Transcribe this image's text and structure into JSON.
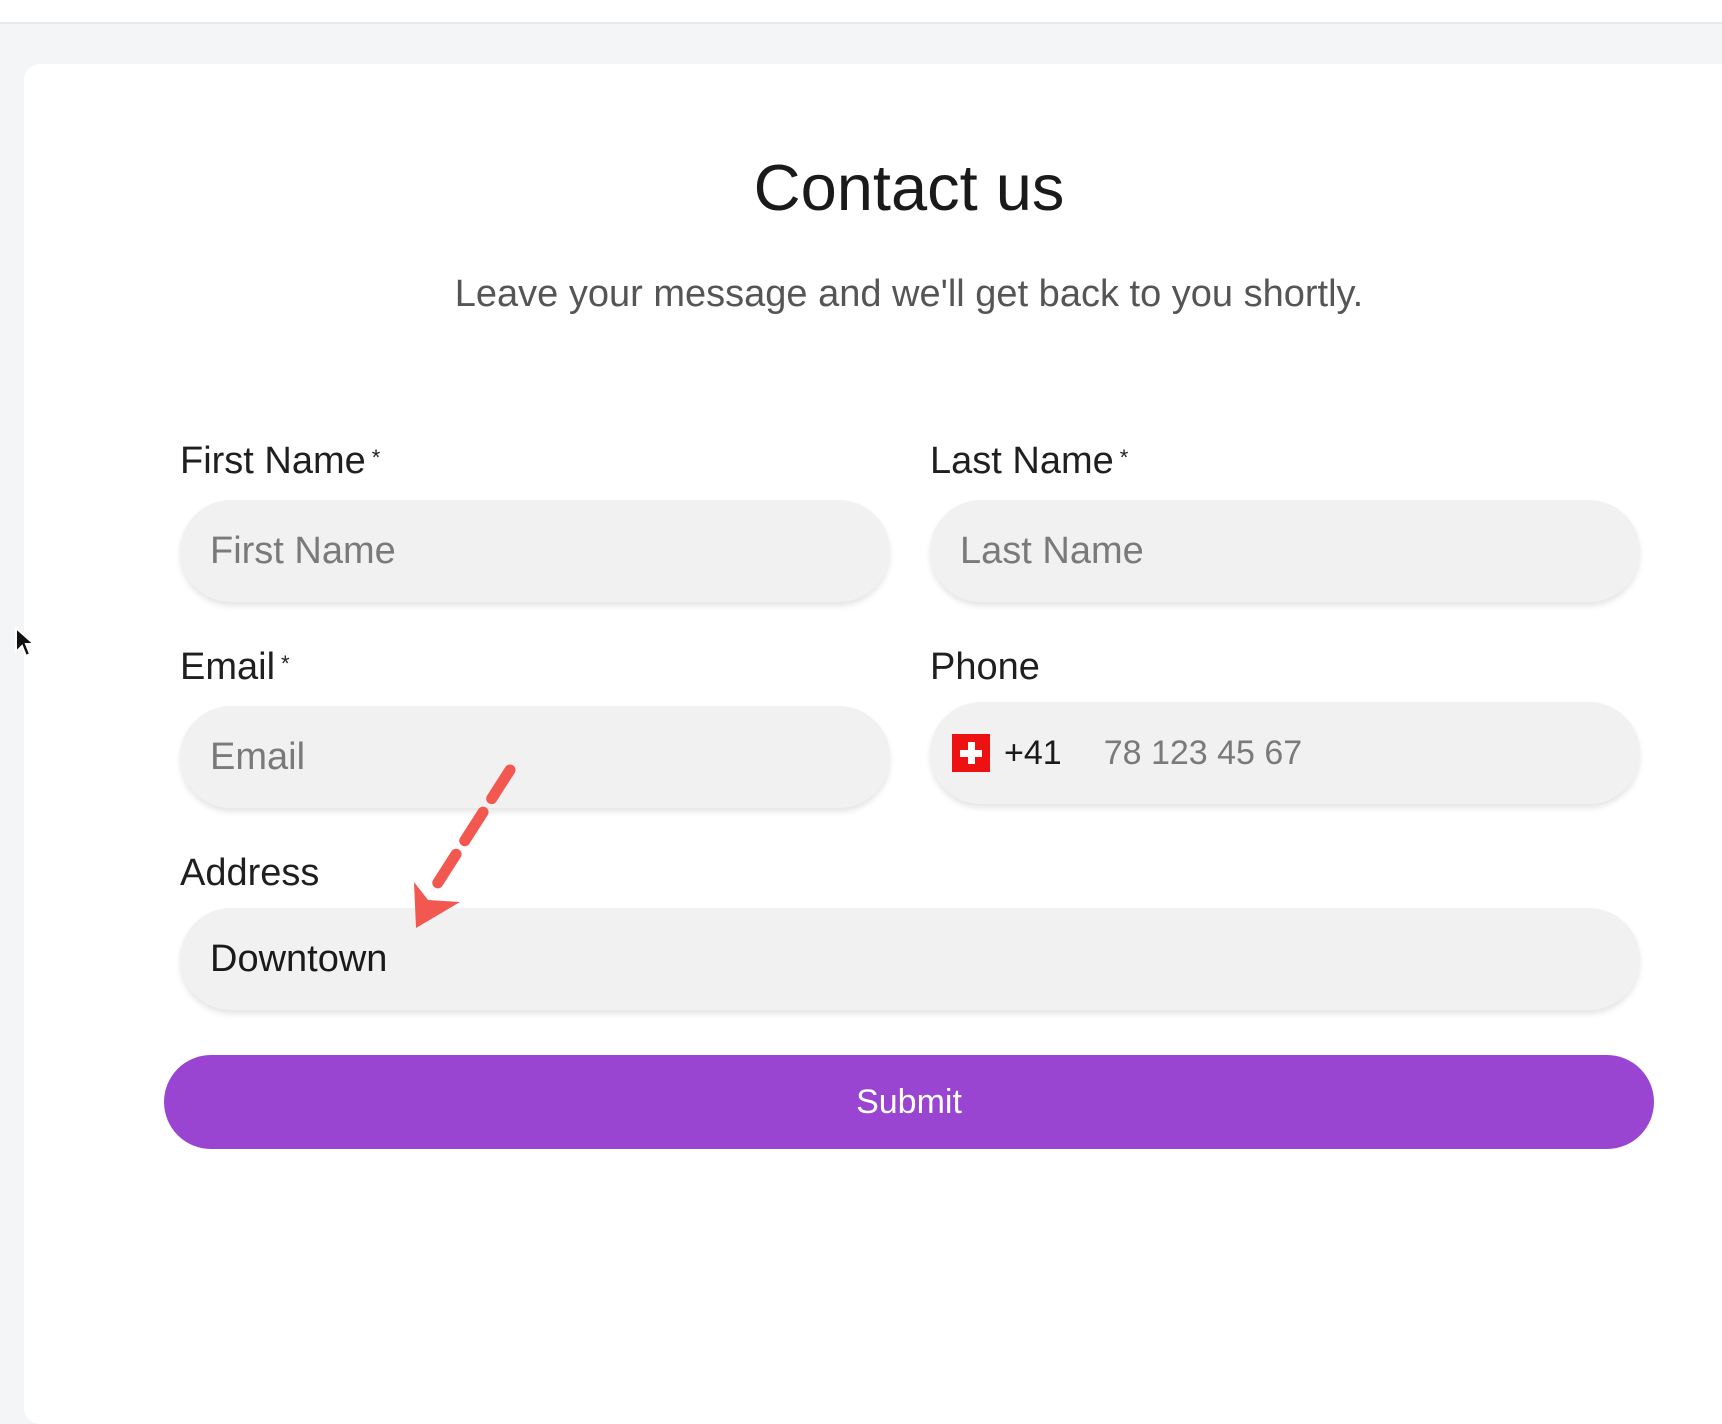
{
  "page": {
    "title": "Contact us",
    "subtitle": "Leave your message and we'll get back to you shortly."
  },
  "form": {
    "first_name": {
      "label": "First Name",
      "required_mark": "*",
      "placeholder": "First Name",
      "value": ""
    },
    "last_name": {
      "label": "Last Name",
      "required_mark": "*",
      "placeholder": "Last Name",
      "value": ""
    },
    "email": {
      "label": "Email",
      "required_mark": "*",
      "placeholder": "Email",
      "value": ""
    },
    "phone": {
      "label": "Phone",
      "country_icon": "swiss-flag-icon",
      "country_code": "+41",
      "placeholder": "78 123 45 67",
      "value": ""
    },
    "address": {
      "label": "Address",
      "placeholder": "",
      "value": "Downtown"
    },
    "submit_label": "Submit"
  },
  "colors": {
    "accent": "#9945d1",
    "field_background": "#f1f1f1",
    "annotation_arrow": "#f2584f",
    "flag_red": "#ee1111"
  },
  "annotations": {
    "arrow_icon": "annotation-arrow-icon",
    "cursor_icon": "mouse-pointer-icon"
  }
}
